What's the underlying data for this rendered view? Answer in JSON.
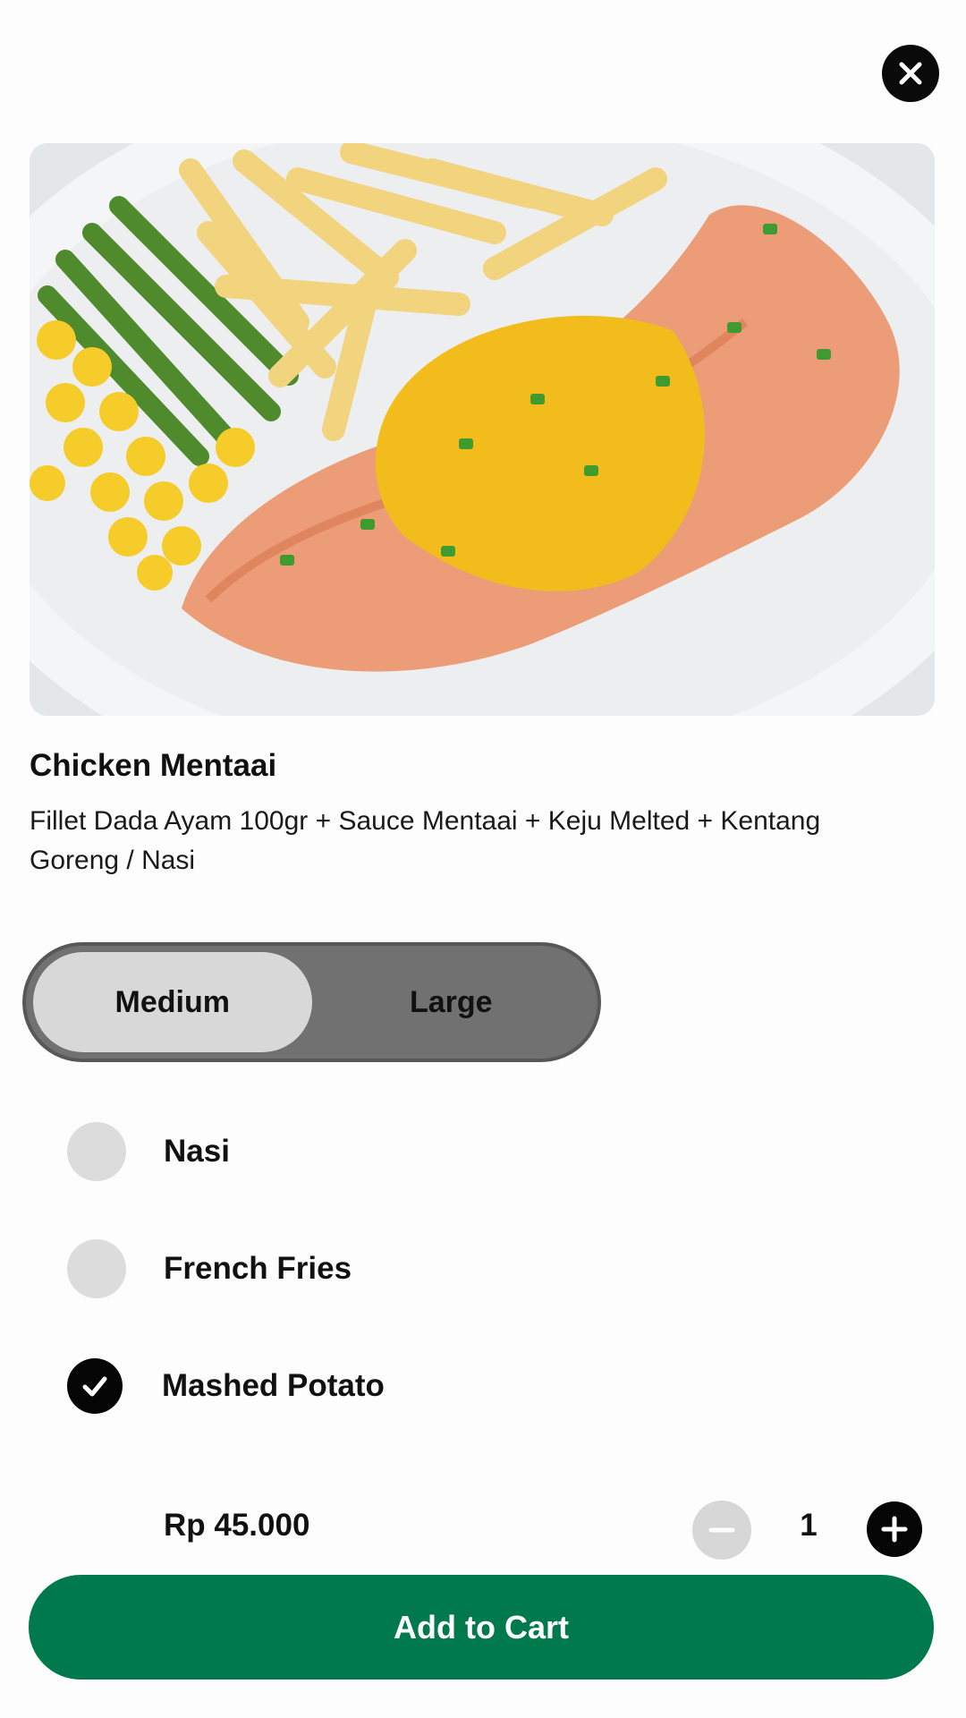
{
  "product": {
    "name": "Chicken Mentaai",
    "description": "Fillet Dada Ayam 100gr + Sauce Mentaai + Keju Melted + Kentang Goreng / Nasi",
    "image_icon": "food-photo"
  },
  "size_options": {
    "selected": "Medium",
    "items": [
      {
        "label": "Medium",
        "active": true
      },
      {
        "label": "Large",
        "active": false
      }
    ]
  },
  "side_options": {
    "items": [
      {
        "label": "Nasi",
        "checked": false
      },
      {
        "label": "French Fries",
        "checked": false
      },
      {
        "label": "Mashed Potato",
        "checked": true
      }
    ]
  },
  "order": {
    "price": "Rp 45.000",
    "quantity": "1"
  },
  "actions": {
    "add_to_cart": "Add to Cart",
    "close_icon": "close-icon",
    "minus_icon": "minus-icon",
    "plus_icon": "plus-icon"
  },
  "colors": {
    "primary": "#007a4d",
    "dark": "#050505",
    "toggle_bg": "#717171",
    "toggle_active": "#d8d8d8",
    "radio_off": "#dcdcdc"
  }
}
